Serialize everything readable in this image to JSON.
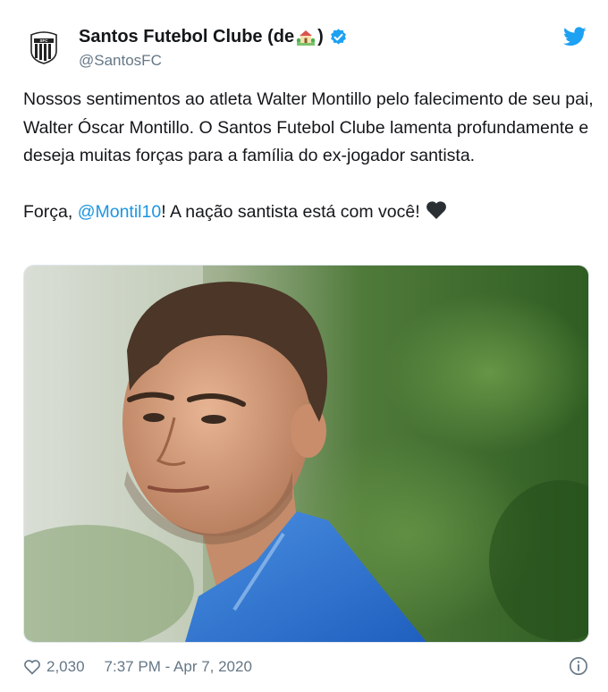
{
  "tweet": {
    "display_name_prefix": "Santos Futebol Clube (de",
    "display_name_suffix": ")",
    "handle": "@SantosFC",
    "text_line1": "Nossos sentimentos ao atleta Walter Montillo pelo falecimento de seu pai, Walter Óscar Montillo. O Santos Futebol Clube lamenta profundamente e deseja muitas forças para a família do ex-jogador santista.",
    "text_line2_prefix": "Força, ",
    "mention": "@Montil10",
    "text_line2_suffix": "! A nação santista está com você!",
    "likes": "2,030",
    "timestamp": "7:37 PM - Apr 7, 2020"
  },
  "icons": {
    "avatar": "santos-crest-icon",
    "house": "house-with-garden-emoji",
    "verified": "verified-badge-icon",
    "platform": "twitter-bird-icon",
    "heart_emoji": "black-heart-emoji",
    "like": "heart-outline-icon",
    "info": "info-icon"
  },
  "colors": {
    "text": "#14171a",
    "secondary": "#657786",
    "link": "#1b95e0",
    "verified": "#1da1f2",
    "twitter_blue": "#1da1f2"
  }
}
